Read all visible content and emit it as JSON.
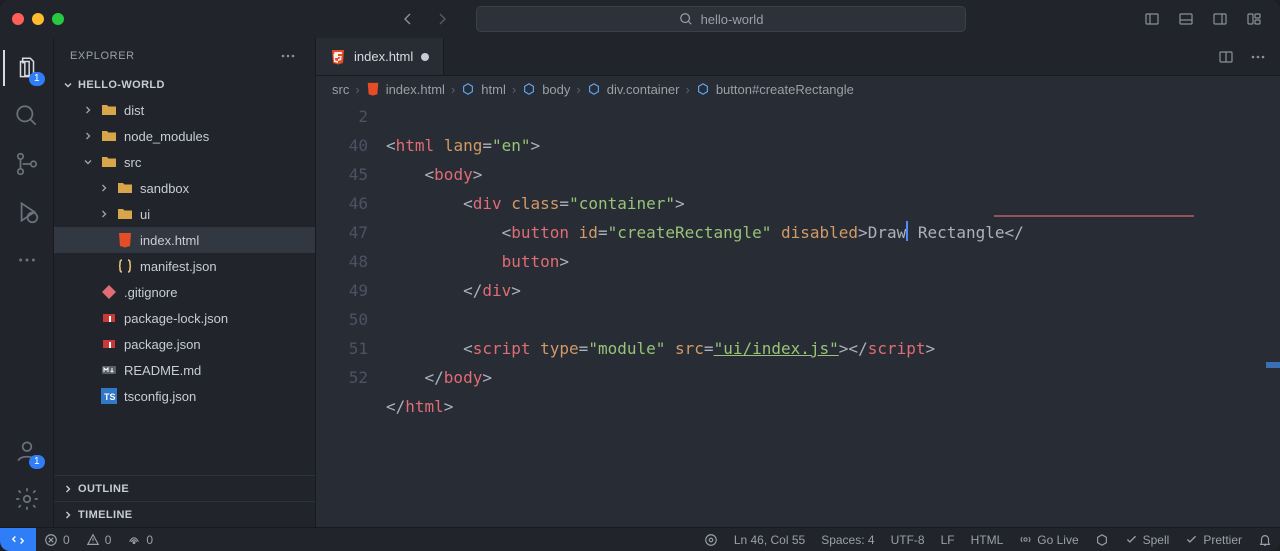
{
  "window": {
    "search_placeholder": "hello-world"
  },
  "sidebar": {
    "title": "EXPLORER",
    "folder": "HELLO-WORLD",
    "tree": [
      {
        "name": "dist",
        "kind": "folder",
        "depth": 1,
        "open": false
      },
      {
        "name": "node_modules",
        "kind": "folder",
        "depth": 1,
        "open": false
      },
      {
        "name": "src",
        "kind": "folder",
        "depth": 1,
        "open": true
      },
      {
        "name": "sandbox",
        "kind": "folder",
        "depth": 2,
        "open": false
      },
      {
        "name": "ui",
        "kind": "folder",
        "depth": 2,
        "open": false
      },
      {
        "name": "index.html",
        "kind": "file-html",
        "depth": 2,
        "selected": true
      },
      {
        "name": "manifest.json",
        "kind": "file-json",
        "depth": 2
      },
      {
        "name": ".gitignore",
        "kind": "file-git",
        "depth": 1
      },
      {
        "name": "package-lock.json",
        "kind": "file-npm",
        "depth": 1
      },
      {
        "name": "package.json",
        "kind": "file-npm",
        "depth": 1
      },
      {
        "name": "README.md",
        "kind": "file-md",
        "depth": 1
      },
      {
        "name": "tsconfig.json",
        "kind": "file-ts",
        "depth": 1
      }
    ],
    "sections": [
      "OUTLINE",
      "TIMELINE"
    ]
  },
  "activity": {
    "explorer_badge": "1",
    "account_badge": "1"
  },
  "tabs": {
    "open": [
      {
        "label": "index.html",
        "icon": "html",
        "dirty": true,
        "active": true
      }
    ]
  },
  "breadcrumb": [
    "src",
    "index.html",
    "html",
    "body",
    "div.container",
    "button#createRectangle"
  ],
  "editor": {
    "line_numbers": [
      "2",
      "40",
      "45",
      "46",
      "",
      "47",
      "48",
      "49",
      "50",
      "51",
      "52"
    ],
    "code": {
      "l2": {
        "tag": "html",
        "attr": "lang",
        "val": "\"en\""
      },
      "l40": {
        "tag": "body"
      },
      "l45": {
        "tag": "div",
        "attr": "class",
        "val": "\"container\""
      },
      "l46": {
        "tag": "button",
        "attr_id": "id",
        "val_id": "\"createRectangle\"",
        "attr_dis": "disabled",
        "text1": "Draw",
        "text2": " Rectangle",
        "closetag": "button"
      },
      "l47": {
        "close": "div"
      },
      "l49": {
        "tag": "script",
        "attr1": "type",
        "val1": "\"module\"",
        "attr2": "src",
        "val2": "\"ui/index.js\"",
        "close": "script"
      },
      "l50": {
        "close": "body"
      },
      "l51": {
        "close": "html"
      }
    }
  },
  "status": {
    "errors": "0",
    "warnings": "0",
    "ports": "0",
    "line_col": "Ln 46, Col 55",
    "spaces": "Spaces: 4",
    "encoding": "UTF-8",
    "eol": "LF",
    "language": "HTML",
    "golive": "Go Live",
    "spell": "Spell",
    "prettier": "Prettier"
  }
}
